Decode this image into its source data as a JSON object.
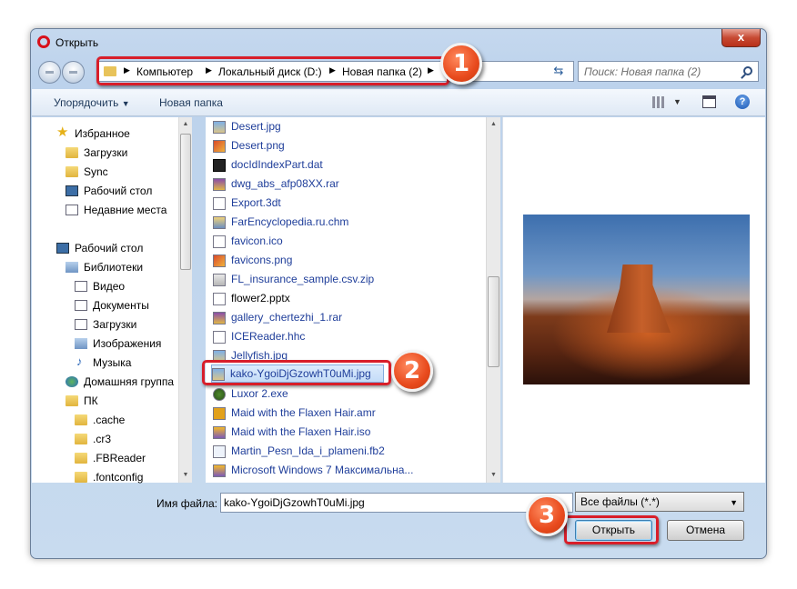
{
  "window": {
    "title": "Открыть",
    "close_label": "x"
  },
  "address": {
    "crumbs": [
      "Компьютер",
      "Локальный диск (D:)",
      "Новая папка (2)"
    ]
  },
  "search": {
    "placeholder": "Поиск: Новая папка (2)"
  },
  "toolbar": {
    "organize": "Упорядочить",
    "new_folder": "Новая папка",
    "help": "?"
  },
  "nav": {
    "items": [
      {
        "label": "Избранное",
        "icon": "star-icon"
      },
      {
        "label": "Загрузки",
        "icon": "downloads-folder-icon"
      },
      {
        "label": "Sync",
        "icon": "folder-icon"
      },
      {
        "label": "Рабочий стол",
        "icon": "desktop-icon"
      },
      {
        "label": "Недавние места",
        "icon": "recent-places-icon"
      },
      {
        "label": "Рабочий стол",
        "icon": "desktop-icon"
      },
      {
        "label": "Библиотеки",
        "icon": "library-icon"
      },
      {
        "label": "Видео",
        "icon": "video-library-icon"
      },
      {
        "label": "Документы",
        "icon": "documents-library-icon"
      },
      {
        "label": "Загрузки",
        "icon": "downloads-library-icon"
      },
      {
        "label": "Изображения",
        "icon": "pictures-library-icon"
      },
      {
        "label": "Музыка",
        "icon": "music-icon"
      },
      {
        "label": "Домашняя группа",
        "icon": "homegroup-icon"
      },
      {
        "label": "ПК",
        "icon": "computer-icon"
      },
      {
        "label": ".cache",
        "icon": "folder-icon"
      },
      {
        "label": ".cr3",
        "icon": "folder-icon"
      },
      {
        "label": ".FBReader",
        "icon": "folder-icon"
      },
      {
        "label": ".fontconfig",
        "icon": "folder-icon"
      }
    ]
  },
  "files": [
    {
      "name": "Desert.jpg",
      "icon": "jpg-icon"
    },
    {
      "name": "Desert.png",
      "icon": "png-icon"
    },
    {
      "name": "docIdIndexPart.dat",
      "icon": "dat-icon"
    },
    {
      "name": "dwg_abs_afp08XX.rar",
      "icon": "rar-icon"
    },
    {
      "name": "Export.3dt",
      "icon": "file-icon"
    },
    {
      "name": "FarEncyclopedia.ru.chm",
      "icon": "chm-icon"
    },
    {
      "name": "favicon.ico",
      "icon": "file-icon"
    },
    {
      "name": "favicons.png",
      "icon": "png-icon"
    },
    {
      "name": "FL_insurance_sample.csv.zip",
      "icon": "zip-icon"
    },
    {
      "name": "flower2.pptx",
      "icon": "file-icon"
    },
    {
      "name": "gallery_chertezhi_1.rar",
      "icon": "rar-icon"
    },
    {
      "name": "ICEReader.hhc",
      "icon": "file-icon"
    },
    {
      "name": "Jellyfish.jpg",
      "icon": "jpg-icon"
    },
    {
      "name": "kako-YgoiDjGzowhT0uMi.jpg",
      "icon": "jpg-icon",
      "selected": true
    },
    {
      "name": "Luxor 2.exe",
      "icon": "exe-icon"
    },
    {
      "name": "Maid with the Flaxen Hair.amr",
      "icon": "amr-icon"
    },
    {
      "name": "Maid with the Flaxen Hair.iso",
      "icon": "iso-icon"
    },
    {
      "name": "Martin_Pesn_Ida_i_plameni.fb2",
      "icon": "fb2-icon"
    },
    {
      "name": "Microsoft Windows 7 Максимальна...",
      "icon": "iso-icon"
    }
  ],
  "filename": {
    "label": "Имя файла:",
    "value": "kako-YgoiDjGzowhT0uMi.jpg"
  },
  "filter": {
    "value": "Все файлы (*.*)"
  },
  "buttons": {
    "open": "Открыть",
    "cancel": "Отмена"
  },
  "callouts": [
    "1",
    "2",
    "3"
  ],
  "colors": {
    "callout_border": "#d81e2a",
    "callout_badge": "#e84a1d",
    "link_text": "#1f3e9a"
  }
}
